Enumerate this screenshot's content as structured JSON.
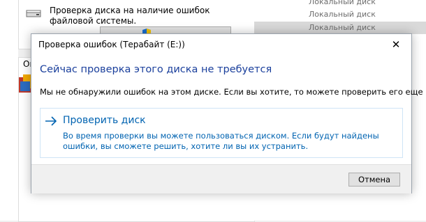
{
  "background": {
    "check_text": "Проверка диска на наличие ошибок файловой системы.",
    "options_label": "Оп",
    "right_rows": [
      "Локальный диск",
      "Локальный диск",
      "Локальный диск"
    ]
  },
  "dialog": {
    "title": "Проверка ошибок (Терабайт (E:))",
    "close_glyph": "✕",
    "heading": "Сейчас проверка этого диска не требуется",
    "message": "Мы не обнаружили ошибок на этом диске. Если вы хотите, то можете проверить его еще раз.",
    "option": {
      "title": "Проверить диск",
      "description": "Во время проверки вы можете пользоваться диском. Если будут найдены ошибки, вы сможете решить, хотите ли вы их устранить."
    },
    "cancel_label": "Отмена"
  },
  "colors": {
    "heading": "#1a3f9c",
    "link": "#0063b1",
    "accent_border": "#cfe4f6",
    "selected_row": "#d9d9d9"
  },
  "icons": [
    "drive-icon",
    "shield-icon",
    "arrow-right-icon",
    "close-icon",
    "defrag-icon"
  ]
}
